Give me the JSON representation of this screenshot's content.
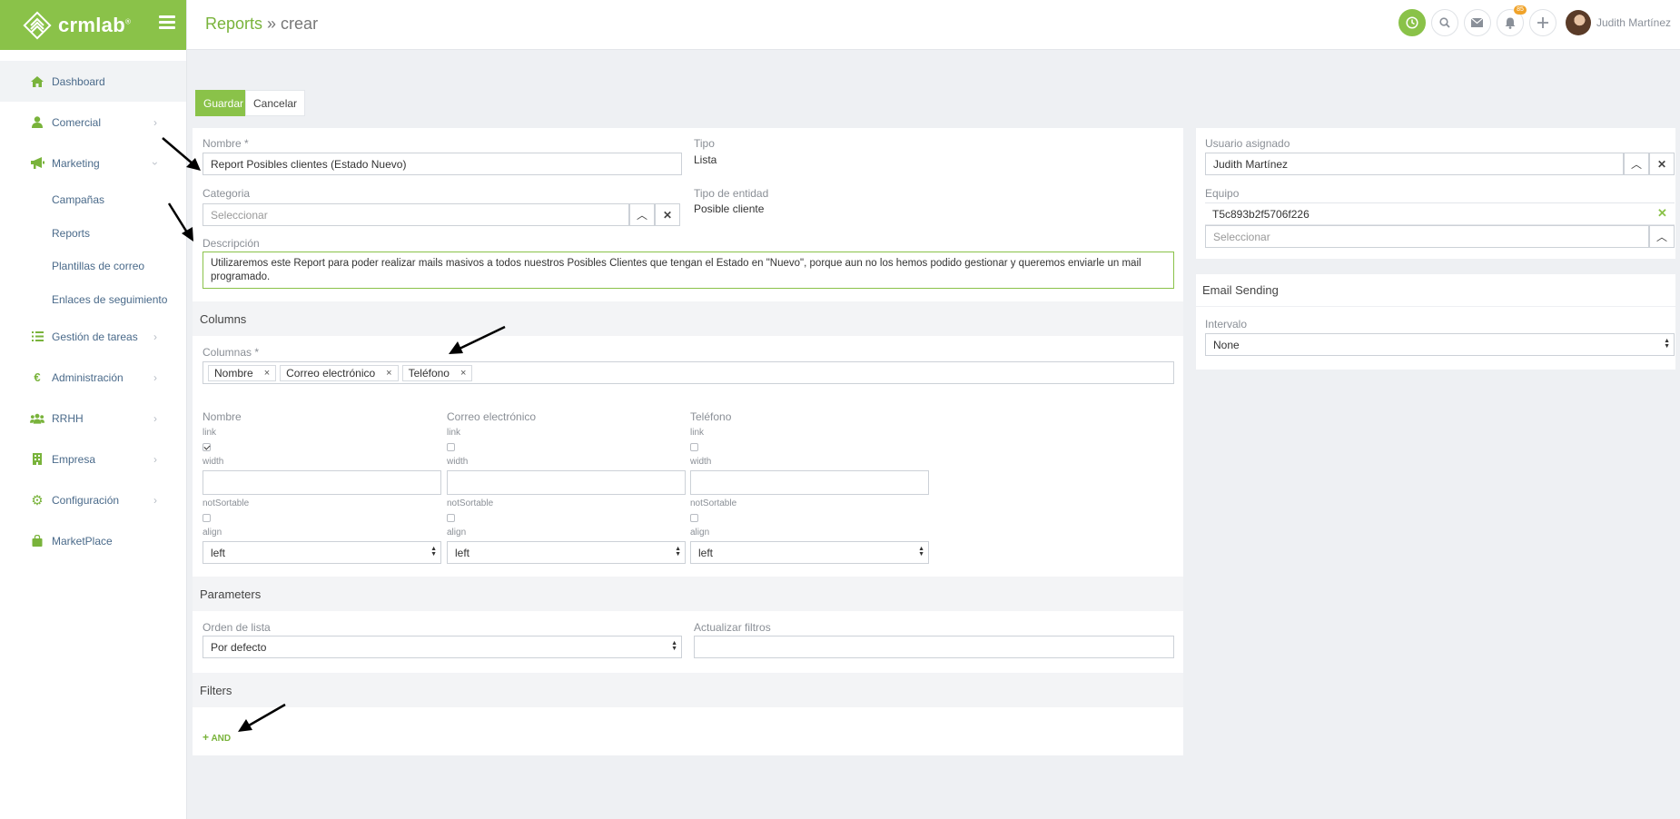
{
  "app": {
    "name": "crmlab",
    "reg": "®"
  },
  "breadcrumb": {
    "link": "Reports",
    "sep": " » ",
    "current": "crear"
  },
  "user": {
    "name": "Judith Martínez"
  },
  "notifications": {
    "count": "85"
  },
  "sidebar": {
    "items": [
      {
        "label": "Dashboard",
        "icon": "home-icon"
      },
      {
        "label": "Comercial",
        "icon": "person-icon"
      },
      {
        "label": "Marketing",
        "icon": "megaphone-icon"
      },
      {
        "label": "Campañas"
      },
      {
        "label": "Reports"
      },
      {
        "label": "Plantillas de correo"
      },
      {
        "label": "Enlaces de seguimiento"
      },
      {
        "label": "Gestión de tareas",
        "icon": "list-icon"
      },
      {
        "label": "Administración",
        "icon": "euro-icon"
      },
      {
        "label": "RRHH",
        "icon": "users-icon"
      },
      {
        "label": "Empresa",
        "icon": "building-icon"
      },
      {
        "label": "Configuración",
        "icon": "gear-icon"
      },
      {
        "label": "MarketPlace",
        "icon": "bag-icon"
      }
    ]
  },
  "actions": {
    "save": "Guardar",
    "cancel": "Cancelar"
  },
  "form": {
    "nombre_label": "Nombre *",
    "nombre_value": "Report Posibles clientes (Estado Nuevo)",
    "tipo_label": "Tipo",
    "tipo_value": "Lista",
    "categoria_label": "Categoria",
    "categoria_placeholder": "Seleccionar",
    "entidad_label": "Tipo de entidad",
    "entidad_value": "Posible cliente",
    "descripcion_label": "Descripción",
    "descripcion_line1": "Utilizaremos este Report para poder realizar mails masivos a todos nuestros Posibles Clientes que tengan el Estado en \"Nuevo\", porque aun no los hemos podido gestionar y queremos enviarle un mail",
    "descripcion_line2": "programado."
  },
  "columns": {
    "section": "Columns",
    "label": "Columnas *",
    "tags": [
      "Nombre",
      "Correo electrónico",
      "Teléfono"
    ],
    "tag_remove": "×",
    "cols": [
      {
        "title": "Nombre",
        "link": true
      },
      {
        "title": "Correo electrónico",
        "link": false
      },
      {
        "title": "Teléfono",
        "link": false
      }
    ],
    "link_label": "link",
    "width_label": "width",
    "notsortable_label": "notSortable",
    "align_label": "align",
    "align_value": "left"
  },
  "parameters": {
    "section": "Parameters",
    "orden_label": "Orden de lista",
    "orden_value": "Por defecto",
    "actualizar_label": "Actualizar filtros"
  },
  "filters": {
    "section": "Filters",
    "add": "AND",
    "add_icon": "+"
  },
  "right": {
    "usuario_label": "Usuario asignado",
    "usuario_value": "Judith Martínez",
    "equipo_label": "Equipo",
    "equipo_value": "T5c893b2f5706f226",
    "equipo_placeholder": "Seleccionar",
    "email_section": "Email Sending",
    "intervalo_label": "Intervalo",
    "intervalo_value": "None"
  },
  "colors": {
    "accent": "#8ac249",
    "link": "#79b33b",
    "nav_text": "#4a6a8a"
  }
}
